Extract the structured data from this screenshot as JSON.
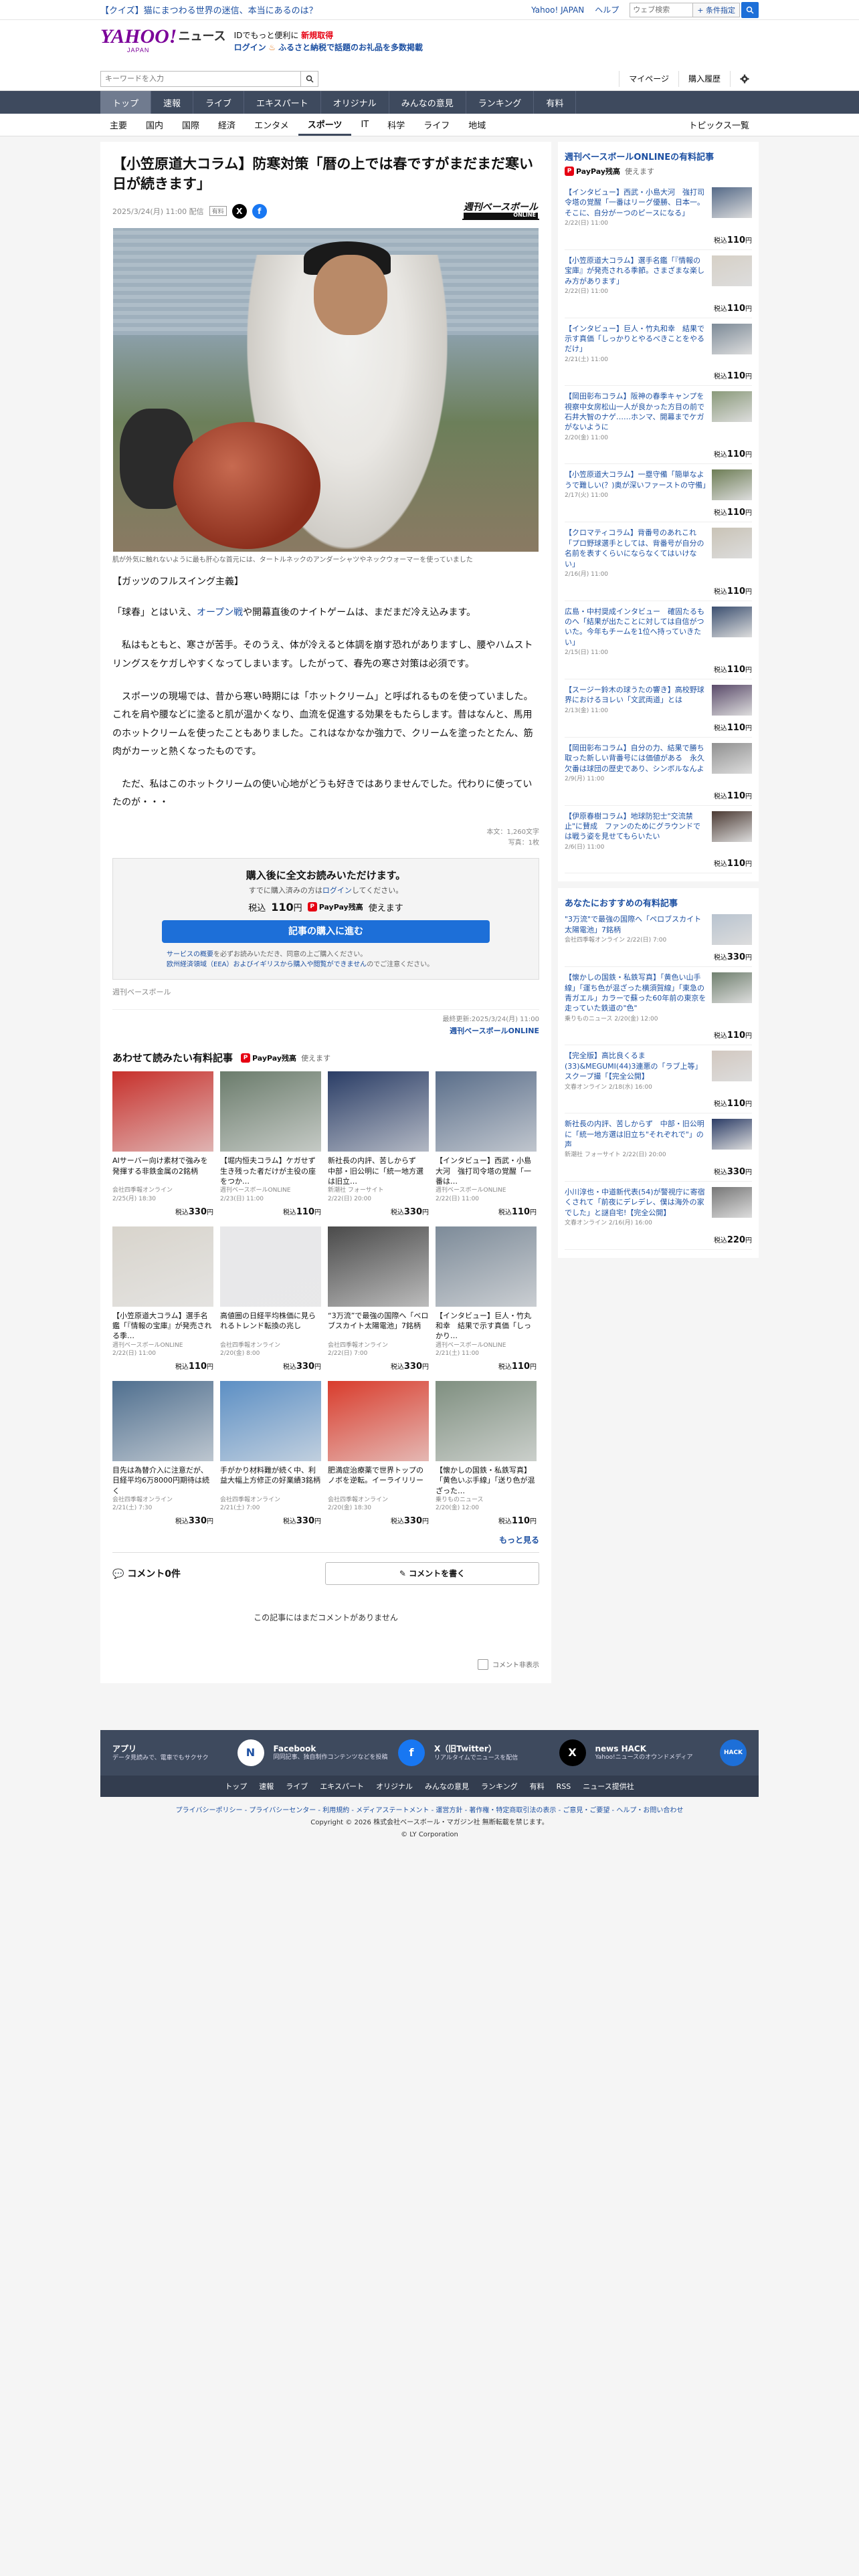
{
  "topbar": {
    "promo": "【クイズ】猫にまつわる世界の迷信、本当にあるのは？",
    "yahoo_japan": "Yahoo! JAPAN",
    "help": "ヘルプ",
    "search_placeholder": "ウェブ検索",
    "search_button": "検索",
    "search_help": "+ 条件指定"
  },
  "header": {
    "logo": "YAHOO!",
    "logo_sub": "JAPAN",
    "news": "ニュース",
    "promo_line1_a": "IDでもっと便利に",
    "promo_line1_b": "新規取得",
    "promo_line2_a": "ログイン",
    "promo_line2_b": "ふるさと納税で話題のお礼品を多数掲載"
  },
  "search": {
    "placeholder": "キーワードを入力",
    "mypage": "マイページ",
    "purchased": "購入履歴"
  },
  "nav": {
    "main": [
      "トップ",
      "速報",
      "ライブ",
      "エキスパート",
      "オリジナル",
      "みんなの意見",
      "ランキング",
      "有料"
    ],
    "sub": [
      "主要",
      "国内",
      "国際",
      "経済",
      "エンタメ",
      "スポーツ",
      "IT",
      "科学",
      "ライフ",
      "地域"
    ],
    "topics": "トピックス一覧"
  },
  "article": {
    "title": "【小笠原道大コラム】防寒対策「暦の上では春ですがまだまだ寒い日が続きます」",
    "date": "2025/3/24(月) 11:00 配信",
    "badge": "有料",
    "publisher": "週刊ベースボール",
    "publisher_sub": "ONLINE",
    "caption": "肌が外気に触れないように最も肝心な首元には、タートルネックのアンダーシャツやネックウォーマーを使っていました",
    "lead": "【ガッツのフルスイング主義】",
    "p1_a": "「球春」とはいえ、",
    "p1_kw": "オープン戦",
    "p1_b": "や開幕直後のナイトゲームは、まだまだ冷え込みます。",
    "p2": "　私はもともと、寒さが苦手。そのうえ、体が冷えると体調を崩す恐れがありますし、腰やハムストリングスをケガしやすくなってしまいます。したがって、春先の寒さ対策は必須です。",
    "p3": "　スポーツの現場では、昔から寒い時期には「ホットクリーム」と呼ばれるものを使っていました。これを肩や腰などに塗ると肌が温かくなり、血流を促進する効果をもたらします。昔はなんと、馬用のホットクリームを使ったこともありました。これはなかなか強力で、クリームを塗ったとたん、筋肉がカーッと熱くなったものです。",
    "p4": "　ただ、私はこのホットクリームの使い心地がどうも好きではありませんでした。代わりに使っていたのが・・・",
    "chars": "本文：1,260文字",
    "photos": "写真：1枚"
  },
  "buy": {
    "title": "購入後に全文お読みいただけます。",
    "sub_a": "すでに購入済みの方は",
    "sub_link": "ログイン",
    "sub_b": "してください。",
    "price_label": "税込",
    "price": "110",
    "price_unit": "円",
    "paypay": "PayPay残高",
    "paypay_b": "使えます",
    "button": "記事の購入に進む",
    "note_a": "サービスの概要",
    "note_b": "を必ずお読みいただき、同意の上ご購入ください。",
    "note_c": "欧州経済領域（EEA）およびイギリスから購入や閲覧ができません",
    "note_d": "のでご注意ください。"
  },
  "source_name": "週刊ベースボール",
  "update": {
    "label": "最終更新:2025/3/24(月) 11:00",
    "publisher": "週刊ベースボールONLINE"
  },
  "related": {
    "title": "あわせて読みたい有料記事",
    "paypay": "PayPay残高",
    "paypay_b": "使えます",
    "more": "もっと見る",
    "price_label": "税込",
    "items": [
      {
        "title": "AIサーバー向け素材で強みを発揮する非鉄金属の2銘柄",
        "source": "会社四季報オンライン",
        "date": "2/25(月) 18:30",
        "price": "330",
        "color": "#c7302b"
      },
      {
        "title": "【堀内恒夫コラム】ケガせず生き残った者だけが主役の座をつか…",
        "source": "週刊ベースボールONLINE",
        "date": "2/23(日) 11:00",
        "price": "110",
        "color": "#6b7c6c"
      },
      {
        "title": "新社長の内評、苦しからず　中部・旧公明に「統一地方選は旧立…",
        "source": "新潮社 フォーサイト",
        "date": "2/22(日) 20:00",
        "price": "330",
        "color": "#2a3d66"
      },
      {
        "title": "【インタビュー】西武・小島大河　強打司令塔の覚醒「一番は…",
        "source": "週刊ベースボールONLINE",
        "date": "2/22(日) 11:00",
        "price": "110",
        "color": "#5a6e8a"
      },
      {
        "title": "【小笠原道大コラム】選手名鑑「『情報の宝庫』が発売される季…",
        "source": "週刊ベースボールONLINE",
        "date": "2/22(日) 11:00",
        "price": "110",
        "color": "#d8d4cc"
      },
      {
        "title": "高値圏の日経平均株価に見られるトレンド転換の兆し",
        "source": "会社四季報オンライン",
        "date": "2/20(金) 8:00",
        "price": "330",
        "color": "#e8e8ea"
      },
      {
        "title": "“3万流”で最強の国際へ「ベロブスカイト太陽電池」7銘柄",
        "source": "会社四季報オンライン",
        "date": "2/22(日) 7:00",
        "price": "330",
        "color": "#4a4a4a"
      },
      {
        "title": "【インタビュー】巨人・竹丸和幸　結果で示す真価「しっかり…",
        "source": "週刊ベースボールONLINE",
        "date": "2/21(土) 11:00",
        "price": "110",
        "color": "#7d8b99"
      },
      {
        "title": "目先は為替介入に注意だが、日経平均6万8000円期待は続く",
        "source": "会社四季報オンライン",
        "date": "2/21(土) 7:30",
        "price": "330",
        "color": "#4f6f8f"
      },
      {
        "title": "手がかり材料難が続く中、利益大幅上方修正の好業績3銘柄",
        "source": "会社四季報オンライン",
        "date": "2/21(土) 7:00",
        "price": "330",
        "color": "#5c8fc4"
      },
      {
        "title": "肥満症治療薬で世界トップのノボを逆転。イーライリリー",
        "source": "会社四季報オンライン",
        "date": "2/20(金) 18:30",
        "price": "330",
        "color": "#d93c2c"
      },
      {
        "title": "【懐かしの国鉄・私鉄写真】「黄色いぶ手線」「送り色が混ざった…",
        "source": "乗りものニュース",
        "date": "2/20(金) 12:00",
        "price": "110",
        "color": "#7f8f80"
      }
    ]
  },
  "comments": {
    "title": "コメント0件",
    "write": "コメントを書く",
    "empty": "この記事にはまだコメントがありません",
    "off": "コメント非表示"
  },
  "sidebar": {
    "box1_title": "週刊ベースボールONLINEの有料記事",
    "paypay": "PayPay残高",
    "paypay_b": "使えます",
    "price_label": "税込",
    "items": [
      {
        "title": "【インタビュー】西武・小島大河　強打司令塔の覚醒「一番はリーグ優勝、日本一。そこに、自分がーつのピースになる」",
        "date": "2/22(日) 11:00",
        "price": "110",
        "color": "#556a88"
      },
      {
        "title": "【小笠原道大コラム】選手名鑑「『情報の宝庫』が発売される季節。さまざまな楽しみ方があります」",
        "date": "2/22(日) 11:00",
        "price": "110",
        "color": "#d6d0c6"
      },
      {
        "title": "【インタビュー】巨人・竹丸和幸　結果で示す真価「しっかりとやるべきことをやるだけ」",
        "date": "2/21(土) 11:00",
        "price": "110",
        "color": "#7c8a97"
      },
      {
        "title": "【岡田彰布コラム】阪神の春季キャンプを視察中女房松山一人が良かった方目の前で石井大智のナゲ……ホンマ、開幕までケガがないように",
        "date": "2/20(金) 11:00",
        "price": "110",
        "color": "#8a9a7a"
      },
      {
        "title": "【小笠原道大コラム】一塁守備「簡単なようで難しい(？)奥が深いファーストの守備」",
        "date": "2/17(火) 11:00",
        "price": "110",
        "color": "#6d7d55"
      },
      {
        "title": "【クロマティコラム】背番号のあれこれ「プロ野球選手としては、背番号が自分の名前を表すくらいにならなくてはいけない」",
        "date": "2/16(月) 11:00",
        "price": "110",
        "color": "#c9c3b6"
      },
      {
        "title": "広島・中村奨成インタビュー　確固たるものへ「結果が出たことに対しては自信がついた。今年もチームを1位へ持っていきたい」",
        "date": "2/15(日) 11:00",
        "price": "110",
        "color": "#3b4f70"
      },
      {
        "title": "【スージー鈴木の球うたの響き】高校野球界におけるヨレい「文武両道」とは",
        "date": "2/13(金) 11:00",
        "price": "110",
        "color": "#5a4a6a"
      },
      {
        "title": "【岡田彰布コラム】自分の力、結果で勝ち取った新しい背番号には価値がある　永久欠番は球団の歴史であり、シンボルなんよ",
        "date": "2/9(月) 11:00",
        "price": "110",
        "color": "#909090"
      },
      {
        "title": "【伊原春樹コラム】地球防犯士\"交流禁止\"に賛成　ファンのためにグラウンドでは戦う姿を見せてもらいたい",
        "date": "2/6(日) 11:00",
        "price": "110",
        "color": "#4b3a33"
      }
    ],
    "box2_title": "あなたにおすすめの有料記事",
    "items2": [
      {
        "title": "\"3万流\"で最強の国際へ「ペロブスカイト太陽電池」7銘柄",
        "source": "会社四季報オンライン 2/22(日) 7:00",
        "price": "330",
        "color": "#b8c3cf"
      },
      {
        "title": "【懐かしの国鉄・私鉄写真】「黄色い山手線」「運ち色が混ざった横須賀線」「東急の青ガエル」カラーで蘇った60年前の東京を走っていた鉄道の\"色\"",
        "source": "乗りものニュース 2/20(金) 12:00",
        "price": "110",
        "color": "#70806f"
      },
      {
        "title": "【完全版】高比良くるま(33)&MEGUMI(44)3連悪の「ラブ上等」スクープ撮「【完全公開】",
        "source": "文春オンライン 2/18(水) 16:00",
        "price": "110",
        "color": "#d2c8c0"
      },
      {
        "title": "新社長の内評、苦しからず　中部・旧公明に「統一地方選は旧立ち\"それぞれで\"」の声",
        "source": "新潮社 フォーサイト 2/22(日) 20:00",
        "price": "330",
        "color": "#2b3c66"
      },
      {
        "title": "小川淳也・中道新代表(54)が警視庁に寄宿くされて「前夜にデレデレ、僕は海外の家でした」と謎自宅!【完全公開】",
        "source": "文春オンライン 2/16(月) 16:00",
        "price": "220",
        "color": "#777777"
      }
    ]
  },
  "footer": {
    "apps": [
      {
        "title": "アプリ",
        "desc": "データ見読みで、電車でもサクサク",
        "icon": "N",
        "color": "#ffffff",
        "fg": "#1d50a2"
      },
      {
        "title": "Facebook",
        "desc": "同同記事、独自制作コンテンツなどを投稿",
        "icon": "f",
        "color": "#1877f2",
        "fg": "#ffffff"
      },
      {
        "title": "X（旧Twitter）",
        "desc": "リアルタイムでニュースを配信",
        "icon": "X",
        "color": "#000000",
        "fg": "#ffffff"
      },
      {
        "title": "news HACK",
        "desc": "Yahoo!ニュースのオウンドメディア",
        "icon": "HACK",
        "color": "#1d6fd8",
        "fg": "#ffffff"
      }
    ],
    "links": [
      "トップ",
      "速報",
      "ライブ",
      "エキスパート",
      "オリジナル",
      "みんなの意見",
      "ランキング",
      "有料",
      "RSS",
      "ニュース提供社"
    ],
    "legal": "プライバシーポリシー - プライバシーセンター - 利用規約 - メディアステートメント - 運営方針 - 著作権・特定商取引法の表示 - ご意見・ご要望 - ヘルプ・お問い合わせ",
    "copyright": "Copyright © 2026 株式会社ベースボール・マガジン社 無断転載を禁じます。",
    "corp": "© LY Corporation"
  }
}
